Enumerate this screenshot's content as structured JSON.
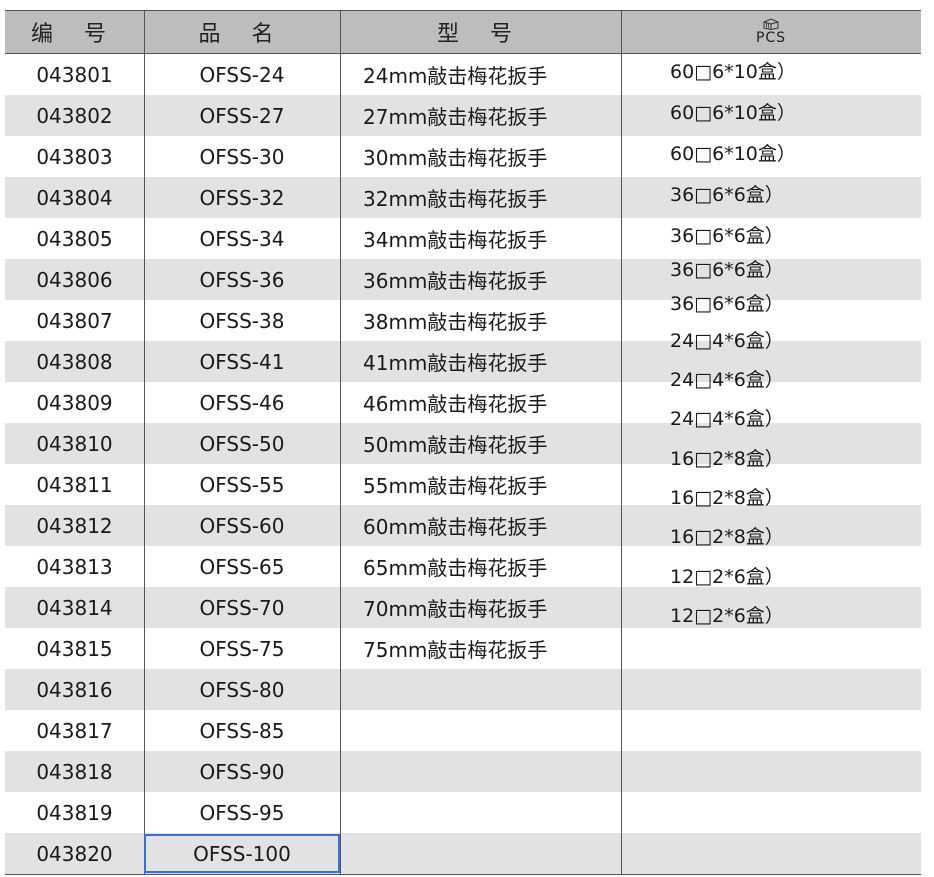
{
  "table": {
    "headers": {
      "code": "编 号",
      "name": "品 名",
      "model": "型 号",
      "pcs": "PCS",
      "pcs_icon": "box-icon"
    },
    "rows": [
      {
        "code": "043801",
        "name": "OFSS-24",
        "model": "24mm敲击梅花扳手"
      },
      {
        "code": "043802",
        "name": "OFSS-27",
        "model": "27mm敲击梅花扳手"
      },
      {
        "code": "043803",
        "name": "OFSS-30",
        "model": "30mm敲击梅花扳手"
      },
      {
        "code": "043804",
        "name": "OFSS-32",
        "model": "32mm敲击梅花扳手"
      },
      {
        "code": "043805",
        "name": "OFSS-34",
        "model": "34mm敲击梅花扳手"
      },
      {
        "code": "043806",
        "name": "OFSS-36",
        "model": "36mm敲击梅花扳手"
      },
      {
        "code": "043807",
        "name": "OFSS-38",
        "model": "38mm敲击梅花扳手"
      },
      {
        "code": "043808",
        "name": "OFSS-41",
        "model": "41mm敲击梅花扳手"
      },
      {
        "code": "043809",
        "name": "OFSS-46",
        "model": "46mm敲击梅花扳手"
      },
      {
        "code": "043810",
        "name": "OFSS-50",
        "model": "50mm敲击梅花扳手"
      },
      {
        "code": "043811",
        "name": "OFSS-55",
        "model": "55mm敲击梅花扳手"
      },
      {
        "code": "043812",
        "name": "OFSS-60",
        "model": "60mm敲击梅花扳手"
      },
      {
        "code": "043813",
        "name": "OFSS-65",
        "model": "65mm敲击梅花扳手"
      },
      {
        "code": "043814",
        "name": "OFSS-70",
        "model": "70mm敲击梅花扳手"
      },
      {
        "code": "043815",
        "name": "OFSS-75",
        "model": "75mm敲击梅花扳手"
      },
      {
        "code": "043816",
        "name": "OFSS-80",
        "model": ""
      },
      {
        "code": "043817",
        "name": "OFSS-85",
        "model": ""
      },
      {
        "code": "043818",
        "name": "OFSS-90",
        "model": ""
      },
      {
        "code": "043819",
        "name": "OFSS-95",
        "model": ""
      },
      {
        "code": "043820",
        "name": "OFSS-100",
        "model": ""
      }
    ],
    "quantities": [
      "60□6*10盒）",
      "60□6*10盒）",
      "60□6*10盒）",
      "36□6*6盒）",
      "36□6*6盒）",
      "36□6*6盒）",
      "36□6*6盒）",
      "24□4*6盒）",
      "24□4*6盒）",
      "24□4*6盒）",
      "16□2*8盒）",
      "16□2*8盒）",
      "16□2*8盒）",
      "12□2*6盒）",
      "12□2*6盒）"
    ],
    "selected_row": 19,
    "colors": {
      "header_bg": "#bdbdbd",
      "stripe_bg": "#e2e2e2",
      "selection_border": "#3a6fd8"
    }
  }
}
